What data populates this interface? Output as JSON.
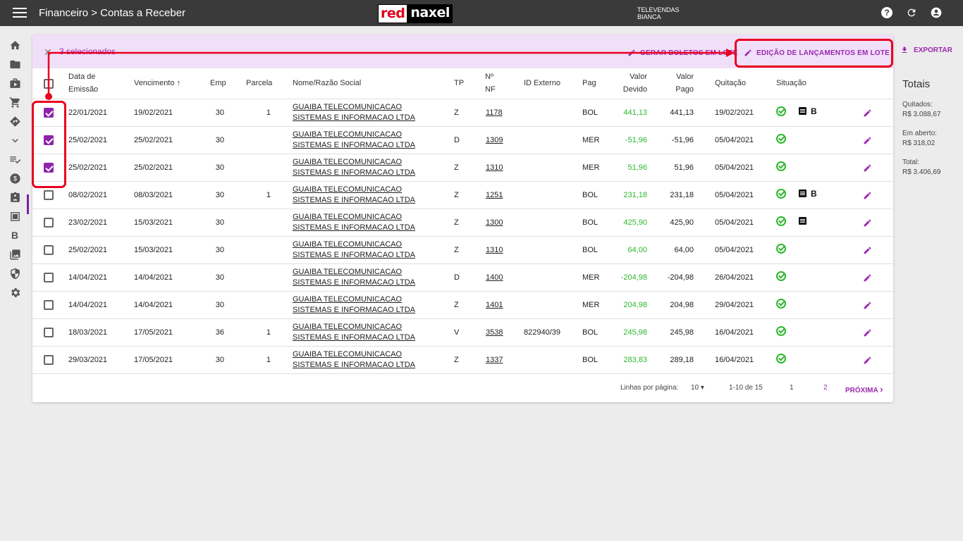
{
  "app": {
    "title": "Financeiro > Contas a Receber",
    "logo_red": "red",
    "logo_black": "naxel"
  },
  "user": {
    "dept": "TELEVENDAS",
    "name": "BIANCA"
  },
  "selection": {
    "count_label": "3 selecionados",
    "gerar_label": "GERAR BOLETOS EM LOTE",
    "edit_label": "EDIÇÃO DE LANÇAMENTOS EM LOTE"
  },
  "export_label": "EXPORTAR",
  "headers": {
    "emissao1": "Data de",
    "emissao2": "Emissão",
    "vencimento": "Vencimento",
    "emp": "Emp",
    "parcela": "Parcela",
    "nome": "Nome/Razão Social",
    "tp": "TP",
    "nf1": "Nº",
    "nf2": "NF",
    "idext": "ID Externo",
    "pag": "Pag",
    "devido1": "Valor",
    "devido2": "Devido",
    "pago1": "Valor",
    "pago2": "Pago",
    "quitacao": "Quitação",
    "situacao": "Situação"
  },
  "rows": [
    {
      "emissao": "22/01/2021",
      "venc": "19/02/2021",
      "emp": "30",
      "parcela": "1",
      "nome": "GUAIBA TELECOMUNICACAO SISTEMAS E INFORMACAO LTDA",
      "tp": "Z",
      "nf": "1178",
      "idext": "",
      "pag": "BOL",
      "devido": "441,13",
      "pago": "441,13",
      "quit": "19/02/2021",
      "checked": true,
      "doc": true,
      "b": "B"
    },
    {
      "emissao": "25/02/2021",
      "venc": "25/02/2021",
      "emp": "30",
      "parcela": "",
      "nome": "GUAIBA TELECOMUNICACAO SISTEMAS E INFORMACAO LTDA",
      "tp": "D",
      "nf": "1309",
      "idext": "",
      "pag": "MER",
      "devido": "-51,96",
      "pago": "-51,96",
      "quit": "05/04/2021",
      "checked": true,
      "doc": false,
      "b": ""
    },
    {
      "emissao": "25/02/2021",
      "venc": "25/02/2021",
      "emp": "30",
      "parcela": "",
      "nome": "GUAIBA TELECOMUNICACAO SISTEMAS E INFORMACAO LTDA",
      "tp": "Z",
      "nf": "1310",
      "idext": "",
      "pag": "MER",
      "devido": "51,96",
      "pago": "51,96",
      "quit": "05/04/2021",
      "checked": true,
      "doc": false,
      "b": ""
    },
    {
      "emissao": "08/02/2021",
      "venc": "08/03/2021",
      "emp": "30",
      "parcela": "1",
      "nome": "GUAIBA TELECOMUNICACAO SISTEMAS E INFORMACAO LTDA",
      "tp": "Z",
      "nf": "1251",
      "idext": "",
      "pag": "BOL",
      "devido": "231,18",
      "pago": "231,18",
      "quit": "05/04/2021",
      "checked": false,
      "doc": true,
      "b": "B"
    },
    {
      "emissao": "23/02/2021",
      "venc": "15/03/2021",
      "emp": "30",
      "parcela": "",
      "nome": "GUAIBA TELECOMUNICACAO SISTEMAS E INFORMACAO LTDA",
      "tp": "Z",
      "nf": "1300",
      "idext": "",
      "pag": "BOL",
      "devido": "425,90",
      "pago": "425,90",
      "quit": "05/04/2021",
      "checked": false,
      "doc": true,
      "b": ""
    },
    {
      "emissao": "25/02/2021",
      "venc": "15/03/2021",
      "emp": "30",
      "parcela": "",
      "nome": "GUAIBA TELECOMUNICACAO SISTEMAS E INFORMACAO LTDA",
      "tp": "Z",
      "nf": "1310",
      "idext": "",
      "pag": "BOL",
      "devido": "64,00",
      "pago": "64,00",
      "quit": "05/04/2021",
      "checked": false,
      "doc": false,
      "b": ""
    },
    {
      "emissao": "14/04/2021",
      "venc": "14/04/2021",
      "emp": "30",
      "parcela": "",
      "nome": "GUAIBA TELECOMUNICACAO SISTEMAS E INFORMACAO LTDA",
      "tp": "D",
      "nf": "1400",
      "idext": "",
      "pag": "MER",
      "devido": "-204,98",
      "pago": "-204,98",
      "quit": "26/04/2021",
      "checked": false,
      "doc": false,
      "b": ""
    },
    {
      "emissao": "14/04/2021",
      "venc": "14/04/2021",
      "emp": "30",
      "parcela": "",
      "nome": "GUAIBA TELECOMUNICACAO SISTEMAS E INFORMACAO LTDA",
      "tp": "Z",
      "nf": "1401",
      "idext": "",
      "pag": "MER",
      "devido": "204,98",
      "pago": "204,98",
      "quit": "29/04/2021",
      "checked": false,
      "doc": false,
      "b": ""
    },
    {
      "emissao": "18/03/2021",
      "venc": "17/05/2021",
      "emp": "36",
      "parcela": "1",
      "nome": "GUAIBA TELECOMUNICACAO SISTEMAS E INFORMACAO LTDA",
      "tp": "V",
      "nf": "3538",
      "idext": "822940/39",
      "pag": "BOL",
      "devido": "245,98",
      "pago": "245,98",
      "quit": "16/04/2021",
      "checked": false,
      "doc": false,
      "b": ""
    },
    {
      "emissao": "29/03/2021",
      "venc": "17/05/2021",
      "emp": "30",
      "parcela": "1",
      "nome": "GUAIBA TELECOMUNICACAO SISTEMAS E INFORMACAO LTDA",
      "tp": "Z",
      "nf": "1337",
      "idext": "",
      "pag": "BOL",
      "devido": "283,83",
      "pago": "289,18",
      "quit": "16/04/2021",
      "checked": false,
      "doc": false,
      "b": ""
    }
  ],
  "pagination": {
    "rows_label": "Linhas por página:",
    "rows_value": "10",
    "range": "1-10 de 15",
    "page1": "1",
    "page2": "2",
    "next": "PRÓXIMA"
  },
  "totals": {
    "title": "Totais",
    "quitados_label": "Quitados:",
    "quitados": "R$ 3.088,67",
    "aberto_label": "Em aberto:",
    "aberto": "R$ 318,02",
    "total_label": "Total:",
    "total": "R$ 3.406,69"
  },
  "colors": {
    "accent": "#9c27b0",
    "positive": "#2db82d",
    "highlight": "#e8001f",
    "topbar": "#3a3a3a"
  }
}
